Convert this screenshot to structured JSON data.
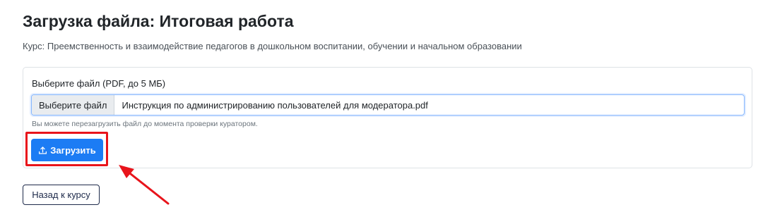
{
  "page": {
    "title": "Загрузка файла: Итоговая работа",
    "course": "Курс: Преемственность и взаимодействие педагогов в дошкольном воспитании, обучении и начальном образовании"
  },
  "upload_form": {
    "file_label": "Выберите файл (PDF, до 5 МБ)",
    "file_button_label": "Выберите файл",
    "selected_file_name": "Инструкция по администрированию пользователей для модератора.pdf",
    "hint": "Вы можете перезагрузить файл до момента проверки куратором.",
    "upload_button_label": "Загрузить",
    "upload_icon": "upload-icon"
  },
  "back_button_label": "Назад к курсу",
  "annotation": {
    "highlight_color": "#e8141b",
    "arrow_color": "#e8141b"
  },
  "colors": {
    "primary": "#1c7cf4",
    "back_button_border": "#1e2a4a"
  }
}
